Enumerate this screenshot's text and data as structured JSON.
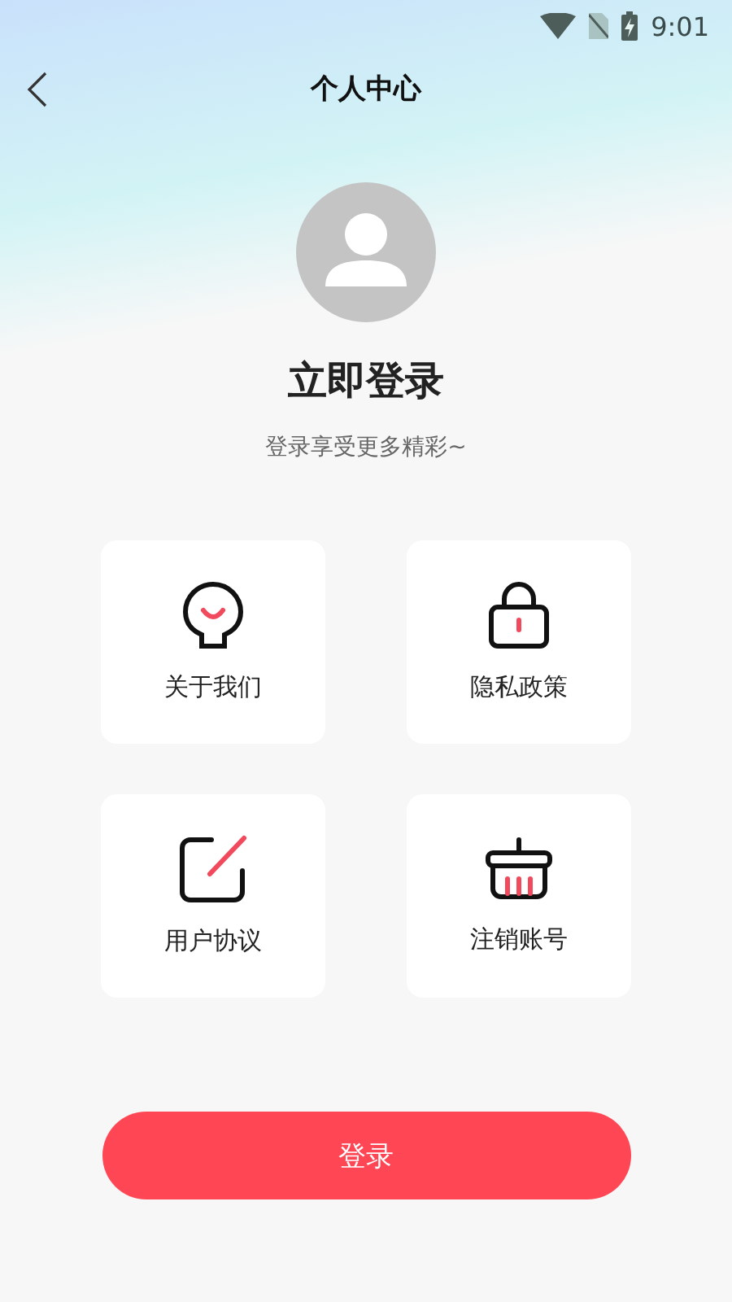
{
  "status_bar": {
    "time": "9:01"
  },
  "header": {
    "title": "个人中心"
  },
  "profile": {
    "title": "立即登录",
    "subtitle": "登录享受更多精彩~"
  },
  "menu": [
    {
      "label": "关于我们",
      "kind": "about"
    },
    {
      "label": "隐私政策",
      "kind": "privacy"
    },
    {
      "label": "用户协议",
      "kind": "agreement"
    },
    {
      "label": "注销账号",
      "kind": "cancel"
    }
  ],
  "login_button": {
    "label": "登录"
  }
}
